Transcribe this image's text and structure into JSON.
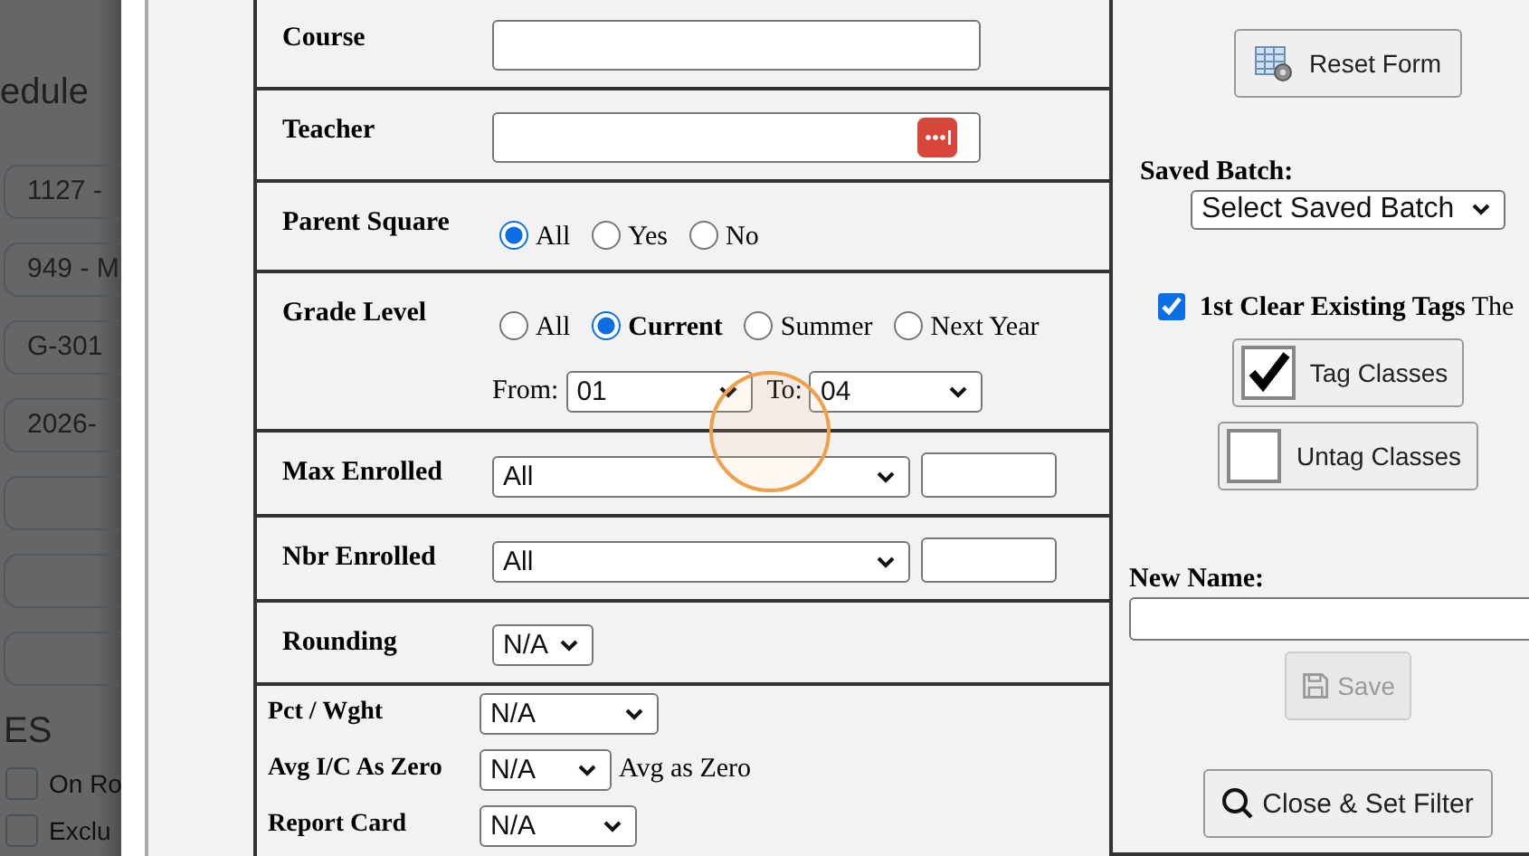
{
  "background_page": {
    "heading": "edule",
    "fields": [
      {
        "kind": "text",
        "value": "1127 -"
      },
      {
        "kind": "text",
        "value": "949 - M"
      },
      {
        "kind": "text",
        "value": "G-301"
      },
      {
        "kind": "text",
        "value": "2026-"
      },
      {
        "kind": "empty"
      },
      {
        "kind": "empty"
      },
      {
        "kind": "empty"
      }
    ],
    "section_heading": "ES",
    "checkboxes": [
      {
        "label": "On Ro",
        "checked": false
      },
      {
        "label": "Exclu",
        "checked": false
      }
    ]
  },
  "filter_form": {
    "rows": [
      {
        "kind": "text",
        "label": "Course"
      },
      {
        "kind": "lookup",
        "label": "Teacher"
      },
      {
        "kind": "radio",
        "label": "Parent Square",
        "options": [
          {
            "label": "All",
            "selected": true
          },
          {
            "label": "Yes",
            "selected": false
          },
          {
            "label": "No",
            "selected": false
          }
        ]
      },
      {
        "kind": "grade",
        "label": "Grade Level",
        "options": [
          {
            "label": "All",
            "selected": false
          },
          {
            "label": "Current",
            "selected": true,
            "bold": true
          },
          {
            "label": "Summer",
            "selected": false
          },
          {
            "label": "Next Year",
            "selected": false
          }
        ],
        "from_label": "From:",
        "from_value": "01",
        "to_label": "To:",
        "to_value": "04"
      },
      {
        "kind": "select_input",
        "label": "Max Enrolled",
        "value": "All"
      },
      {
        "kind": "select_input",
        "label": "Nbr Enrolled",
        "value": "All"
      },
      {
        "kind": "select",
        "label": "Rounding",
        "value": "N/A"
      }
    ],
    "extra_rows": [
      {
        "label": "Pct / Wght",
        "value": "N/A"
      },
      {
        "label": "Avg I/C As Zero",
        "value": "N/A",
        "note": "Avg as Zero"
      },
      {
        "label": "Report Card",
        "value": "N/A"
      }
    ]
  },
  "side_panel": {
    "reset_button": "Reset Form",
    "saved_batch_label": "Saved Batch:",
    "saved_batch_value": "Select Saved Batch",
    "clear_tags": {
      "label": "**1st Clear Existing Tags** The",
      "checked": true
    },
    "tag_button": "Tag Classes",
    "untag_button": "Untag Classes",
    "new_name_label": "New Name:",
    "save_button": {
      "label": "Save",
      "disabled": true
    },
    "close_button": "Close & Set Filter"
  }
}
